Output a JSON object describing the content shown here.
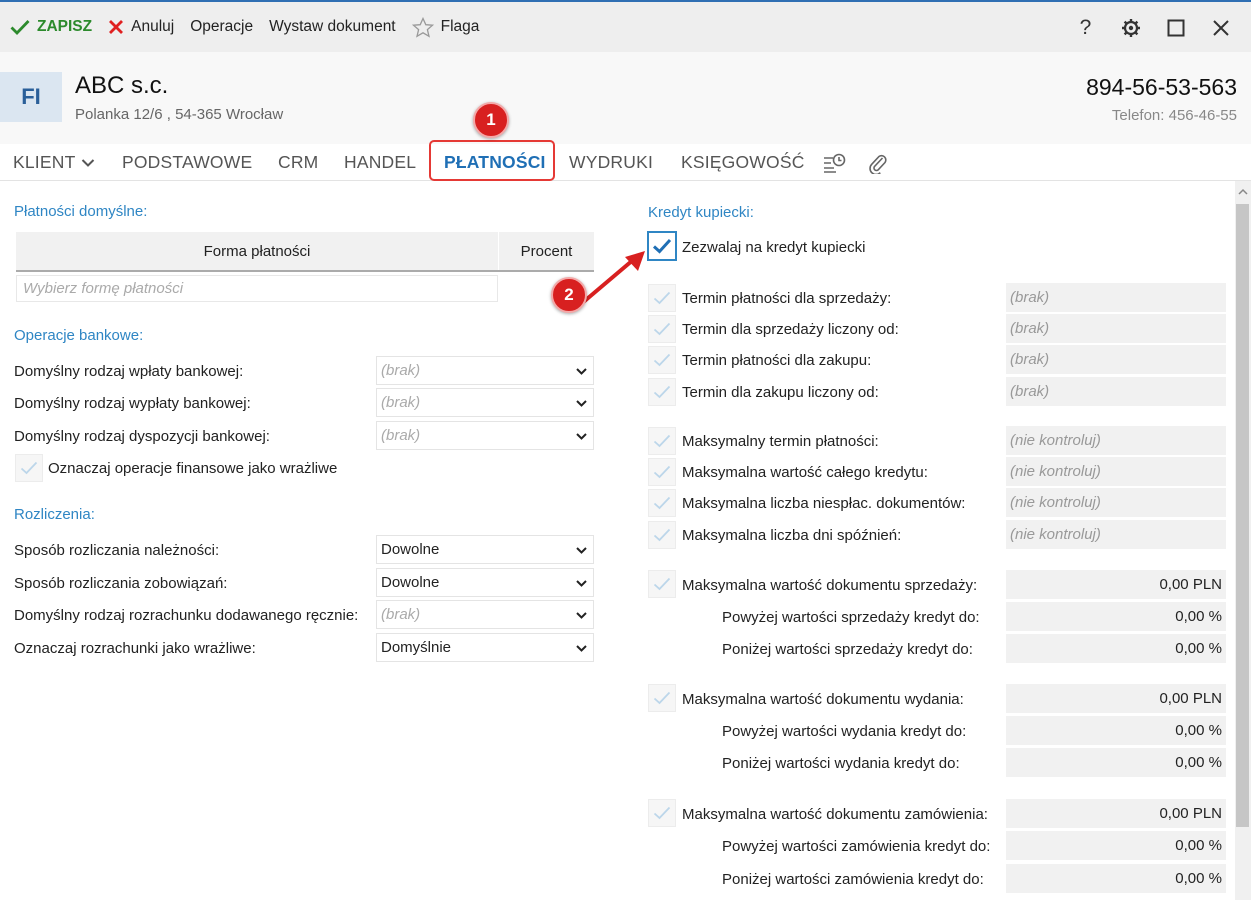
{
  "toolbar": {
    "save_label": "ZAPISZ",
    "cancel_label": "Anuluj",
    "operations_label": "Operacje",
    "issue_doc_label": "Wystaw dokument",
    "flag_label": "Flaga",
    "help_label": "?"
  },
  "header": {
    "badge": "FI",
    "company": "ABC s.c.",
    "address": "Polanka  12/6 , 54-365 Wrocław",
    "nip": "894-56-53-563",
    "phone": "Telefon: 456-46-55"
  },
  "tabs": {
    "klient": "KLIENT",
    "podstawowe": "PODSTAWOWE",
    "crm": "CRM",
    "handel": "HANDEL",
    "platnosci": "PŁATNOŚCI",
    "wydruki": "WYDRUKI",
    "ksiegowosc": "KSIĘGOWOŚĆ"
  },
  "annotations": {
    "one": "1",
    "two": "2"
  },
  "left": {
    "default_payments": {
      "title": "Płatności domyślne:",
      "col_form": "Forma płatności",
      "col_percent": "Procent",
      "placeholder": "Wybierz formę płatności"
    },
    "bank_ops": {
      "title": "Operacje bankowe:",
      "rows": [
        {
          "label": "Domyślny rodzaj wpłaty bankowej:",
          "value": "(brak)"
        },
        {
          "label": "Domyślny rodzaj wypłaty bankowej:",
          "value": "(brak)"
        },
        {
          "label": "Domyślny rodzaj dyspozycji bankowej:",
          "value": "(brak)"
        }
      ],
      "sensitive_label": "Oznaczaj operacje finansowe jako wrażliwe"
    },
    "settlements": {
      "title": "Rozliczenia:",
      "rows": [
        {
          "label": "Sposób rozliczania należności:",
          "value": "Dowolne"
        },
        {
          "label": "Sposób rozliczania zobowiązań:",
          "value": "Dowolne"
        },
        {
          "label": "Domyślny rodzaj rozrachunku dodawanego ręcznie:",
          "value": "(brak)"
        },
        {
          "label": "Oznaczaj rozrachunki jako wrażliwe:",
          "value": "Domyślnie"
        }
      ]
    }
  },
  "credit": {
    "title": "Kredyt kupiecki:",
    "allow_label": "Zezwalaj na kredyt kupiecki",
    "terms": [
      {
        "label": "Termin płatności dla sprzedaży:",
        "value": "(brak)"
      },
      {
        "label": "Termin dla sprzedaży liczony od:",
        "value": "(brak)"
      },
      {
        "label": "Termin płatności dla zakupu:",
        "value": "(brak)"
      },
      {
        "label": "Termin dla zakupu liczony od:",
        "value": "(brak)"
      }
    ],
    "limits": [
      {
        "label": "Maksymalny termin płatności:",
        "value": "(nie kontroluj)"
      },
      {
        "label": "Maksymalna wartość całego kredytu:",
        "value": "(nie kontroluj)"
      },
      {
        "label": "Maksymalna liczba niespłac. dokumentów:",
        "value": "(nie kontroluj)"
      },
      {
        "label": "Maksymalna liczba dni spóźnień:",
        "value": "(nie kontroluj)"
      }
    ],
    "sale": {
      "label": "Maksymalna wartość dokumentu sprzedaży:",
      "value": "0,00 PLN",
      "above_label": "Powyżej wartości sprzedaży kredyt do:",
      "above_value": "0,00 %",
      "below_label": "Poniżej wartości sprzedaży kredyt do:",
      "below_value": "0,00 %"
    },
    "issue": {
      "label": "Maksymalna wartość dokumentu wydania:",
      "value": "0,00 PLN",
      "above_label": "Powyżej wartości wydania kredyt do:",
      "above_value": "0,00 %",
      "below_label": "Poniżej wartości wydania kredyt do:",
      "below_value": "0,00 %"
    },
    "order": {
      "label": "Maksymalna wartość dokumentu zamówienia:",
      "value": "0,00 PLN",
      "above_label": "Powyżej wartości zamówienia kredyt do:",
      "above_value": "0,00 %",
      "below_label": "Poniżej wartości zamówienia kredyt do:",
      "below_value": "0,00 %"
    }
  },
  "colors": {
    "accent": "#2f86c4",
    "save": "#2c8a2c",
    "cancel": "#e02020",
    "highlight": "#e53935"
  }
}
